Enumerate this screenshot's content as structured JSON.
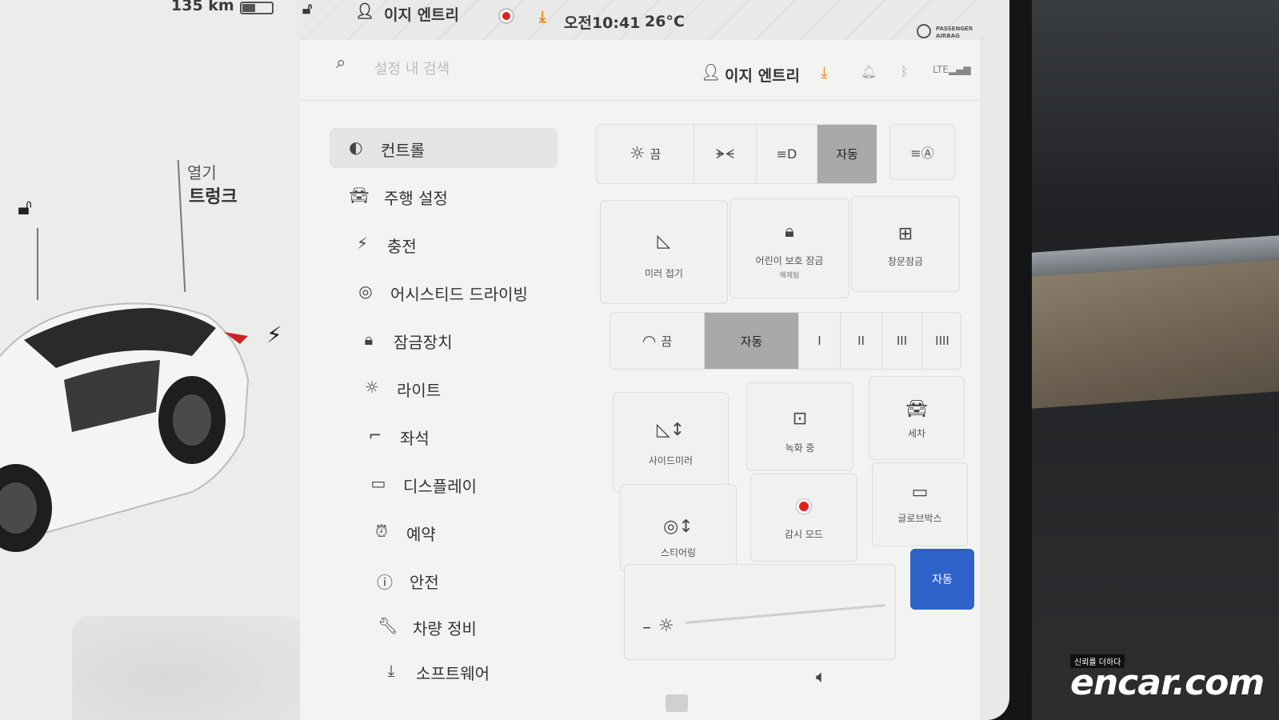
{
  "status": {
    "range": "135 km",
    "user": "이지 엔트리",
    "time": "오전10:41",
    "temperature": "26°C",
    "airbag_line1": "PASSENGER",
    "airbag_line2": "AIRBAG"
  },
  "car": {
    "open_label": "열기",
    "trunk_label": "트렁크"
  },
  "header": {
    "search_placeholder": "설정 내 검색",
    "user": "이지 엔트리",
    "lte": "LTE"
  },
  "menu": {
    "items": [
      {
        "label": "컨트롤",
        "icon": "toggle-icon",
        "active": true
      },
      {
        "label": "주행 설정",
        "icon": "car-icon"
      },
      {
        "label": "충전",
        "icon": "bolt-icon"
      },
      {
        "label": "어시스티드 드라이빙",
        "icon": "steering-wheel-icon"
      },
      {
        "label": "잠금장치",
        "icon": "lock-icon"
      },
      {
        "label": "라이트",
        "icon": "sun-icon"
      },
      {
        "label": "좌석",
        "icon": "seat-icon"
      },
      {
        "label": "디스플레이",
        "icon": "display-icon"
      },
      {
        "label": "예약",
        "icon": "alarm-icon"
      },
      {
        "label": "안전",
        "icon": "alert-icon"
      },
      {
        "label": "차량 정비",
        "icon": "wrench-icon"
      },
      {
        "label": "소프트웨어",
        "icon": "download-icon"
      }
    ]
  },
  "lights": {
    "off_label": "끔",
    "auto_label": "자동",
    "selected": "자동"
  },
  "tiles_row1": {
    "mirror_fold": "미러 접기",
    "child_lock": "어린이 보호 잠금",
    "child_lock_sub": "해제됨",
    "window_lock": "창문잠금"
  },
  "wipers": {
    "off_label": "끔",
    "auto_label": "자동",
    "speeds": [
      "I",
      "II",
      "III",
      "IIII"
    ],
    "selected": "자동"
  },
  "tiles_grid": {
    "side_mirror": "사이드미러",
    "recording": "녹화 중",
    "wash": "세차",
    "steering": "스티어링",
    "sentry": "감시 모드",
    "glovebox": "글로브박스"
  },
  "brightness": {
    "auto_label": "자동"
  },
  "watermark": {
    "tagline": "신뢰를 더하다",
    "brand": "encar.com"
  },
  "colors": {
    "accent_blue": "#2f62c9",
    "record_red": "#e0211d",
    "download_orange": "#e6861a"
  }
}
